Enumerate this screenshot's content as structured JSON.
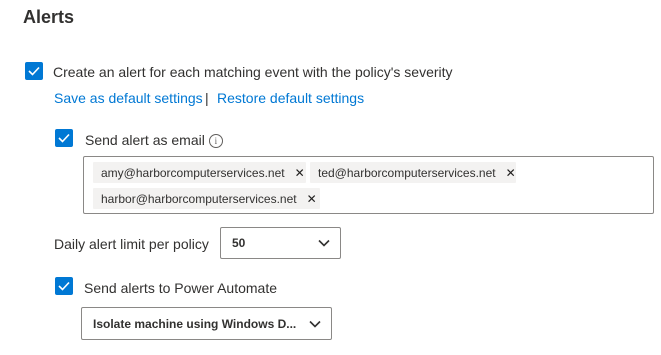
{
  "header": {
    "title": "Alerts"
  },
  "create_alert": {
    "checked": true,
    "label": "Create an alert for each matching event with the policy's severity"
  },
  "links": {
    "save_default": "Save as default settings",
    "separator": "|",
    "restore_default": "Restore default settings"
  },
  "email_alert": {
    "checked": true,
    "label": "Send alert as email",
    "info_icon": "info-icon",
    "info_glyph": "i",
    "recipients": [
      "amy@harborcomputerservices.net",
      "ted@harborcomputerservices.net",
      "harbor@harborcomputerservices.net"
    ],
    "remove_glyph": "✕"
  },
  "daily_limit": {
    "label": "Daily alert limit per policy",
    "value": "50"
  },
  "power_automate": {
    "checked": true,
    "label": "Send alerts to Power Automate",
    "flow_value": "Isolate machine using Windows D..."
  },
  "colors": {
    "accent": "#0078d4",
    "text": "#323130",
    "border": "#8a8886",
    "tag_bg": "#f3f2f1"
  }
}
